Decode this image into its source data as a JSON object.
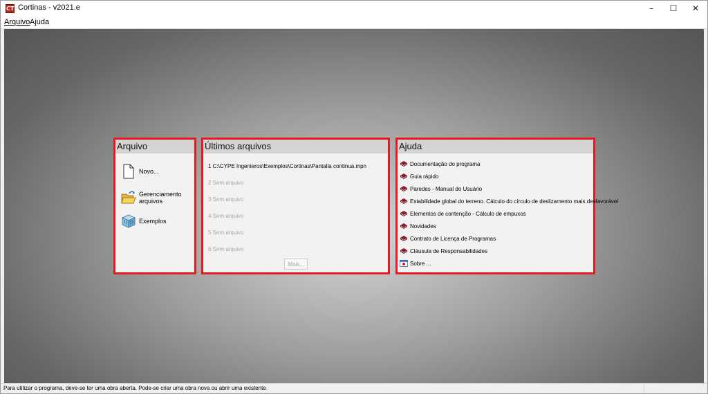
{
  "window": {
    "title": "Cortinas - v2021.e",
    "icon_text": "CT"
  },
  "controls": {
    "minimize": "–",
    "maximize": "☐",
    "close": "✕"
  },
  "menu": {
    "arquivo": "Arquivo",
    "ajuda": "Ajuda"
  },
  "panels": {
    "arquivo": {
      "title": "Arquivo",
      "actions": [
        {
          "label": "Novo...",
          "icon": "new-document-icon"
        },
        {
          "label": "Gerenciamento arquivos",
          "icon": "open-folder-icon"
        },
        {
          "label": "Exemplos",
          "icon": "examples-box-icon"
        }
      ]
    },
    "recent": {
      "title": "Últimos arquivos",
      "items": [
        "1 C:\\CYPE Ingenieros\\Exemplos\\Cortinas\\Pantalla continua.mpn",
        "2 Sem arquivo",
        "3 Sem arquivo",
        "4 Sem arquivo",
        "5 Sem arquivo",
        "6 Sem arquivo"
      ],
      "more_label": "Mais..."
    },
    "help": {
      "title": "Ajuda",
      "items": [
        "Documentação do programa",
        "Guia rápido",
        "Paredes - Manual do Usuário",
        "Estabilidade global do terreno. Cálculo do círculo de deslizamento mais desfavorável",
        "Elementos de contenção - Cálculo de empuxos",
        "Novidades",
        "Contrato de Licença de Programas",
        "Cláusula de Responsabilidades",
        "Sobre ..."
      ]
    }
  },
  "status": {
    "text": "Para utilizar o programa, deve-se ter uma obra aberta. Pode-se criar uma obra nova ou abrir uma existente."
  },
  "colors": {
    "highlight_border": "#e01b24",
    "book_icon": "#8b1a2b"
  }
}
